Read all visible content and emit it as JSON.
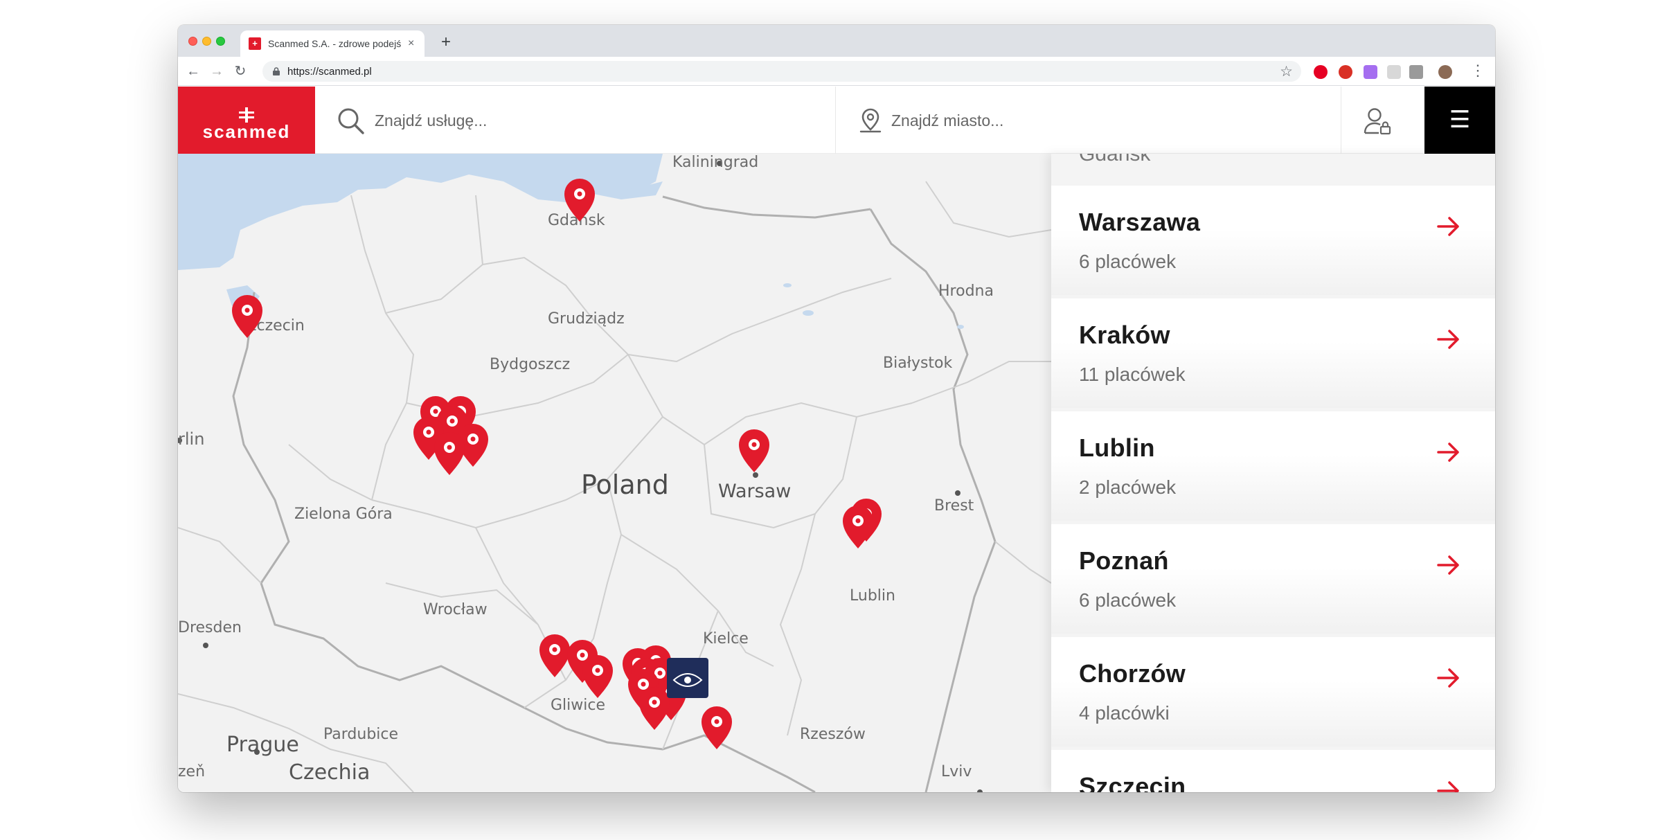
{
  "browser": {
    "tab_title": "Scanmed S.A. - zdrowe podejś",
    "tab_favicon": "+",
    "new_tab": "+",
    "close_tab": "×",
    "url": "https://scanmed.pl",
    "star": "☆",
    "menu": "⋮",
    "back": "←",
    "forward": "→",
    "reload": "↻"
  },
  "header": {
    "logo_text": "scanmed",
    "search_placeholder": "Znajdź usługę...",
    "city_placeholder": "Znajdź miasto...",
    "menu_glyph": "☰",
    "icons": [
      "search-icon",
      "location-pin-icon",
      "user-lock-icon",
      "hamburger-icon"
    ]
  },
  "map": {
    "labels": {
      "kaliningrad": "Kaliningrad",
      "gdansk": "Gdansk",
      "hrodna": "Hrodna",
      "szczecin": "Szczecin",
      "grudziadz": "Grudziądz",
      "bydgoszcz": "Bydgoszcz",
      "bialystok": "Białystok",
      "berlin": "rlin",
      "poland": "Poland",
      "warsaw": "Warsaw",
      "zielona_gora": "Zielona Góra",
      "brest": "Brest",
      "lublin": "Lublin",
      "dresden": "Dresden",
      "wroclaw": "Wrocław",
      "kielce": "Kielce",
      "gliwice": "Gliwice",
      "prague": "Prague",
      "pardubice": "Pardubice",
      "rzeszow": "Rzeszów",
      "czechia": "Czechia",
      "zen": "zeň",
      "lviv": "Lviv"
    },
    "colors": {
      "pin": "#e21b2c",
      "land": "#f2f2f2",
      "water": "#c5d9ee",
      "border": "#c8c8c8"
    }
  },
  "cities": {
    "partial_top": "Gdańsk",
    "items": [
      {
        "name": "Warszawa",
        "count": "6 placówek"
      },
      {
        "name": "Kraków",
        "count": "11 placówek"
      },
      {
        "name": "Lublin",
        "count": "2 placówek"
      },
      {
        "name": "Poznań",
        "count": "6 placówek"
      },
      {
        "name": "Chorzów",
        "count": "4 placówki"
      },
      {
        "name": "Szczecin",
        "count": ""
      }
    ],
    "arrow_color": "#e21b2c"
  }
}
